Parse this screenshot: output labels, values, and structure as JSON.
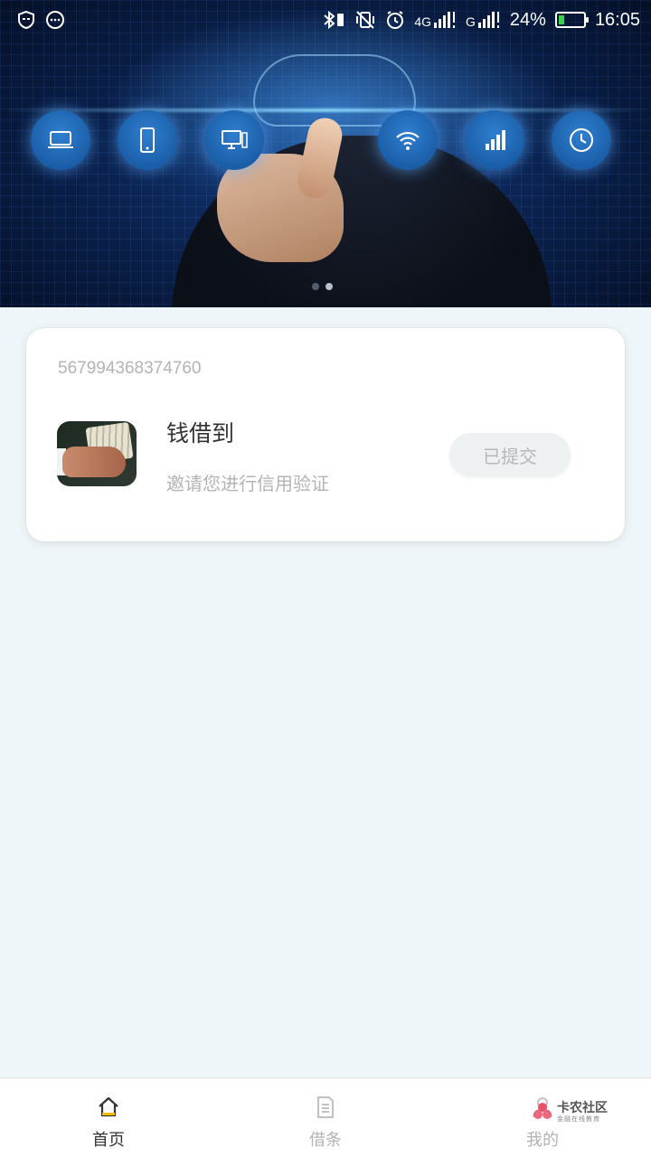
{
  "status_bar": {
    "network_label": "4G",
    "carrier2_label": "G",
    "battery_percent": "24%",
    "battery_level": 0.24,
    "time": "16:05",
    "battery_color": "#39d34a"
  },
  "banner": {
    "icons": [
      "laptop-icon",
      "phone-icon",
      "desktop-icon",
      "wifi-icon",
      "signal-icon",
      "clock-icon"
    ],
    "slides": 2,
    "active_slide": 1
  },
  "card": {
    "id_number": "567994368374760",
    "title": "钱借到",
    "subtitle": "邀请您进行信用验证",
    "action_label": "已提交"
  },
  "tabs": [
    {
      "label": "首页",
      "icon": "home-icon",
      "active": true
    },
    {
      "label": "借条",
      "icon": "document-icon",
      "active": false
    },
    {
      "label": "我的",
      "icon": "profile-icon",
      "active": false
    }
  ],
  "watermark": {
    "main": "卡农社区",
    "sub": "金融在线教育"
  },
  "colors": {
    "background": "#eff6f9",
    "tab_active": "#333333",
    "tab_inactive": "#b3b3b3",
    "home_accent": "#f5b800"
  }
}
